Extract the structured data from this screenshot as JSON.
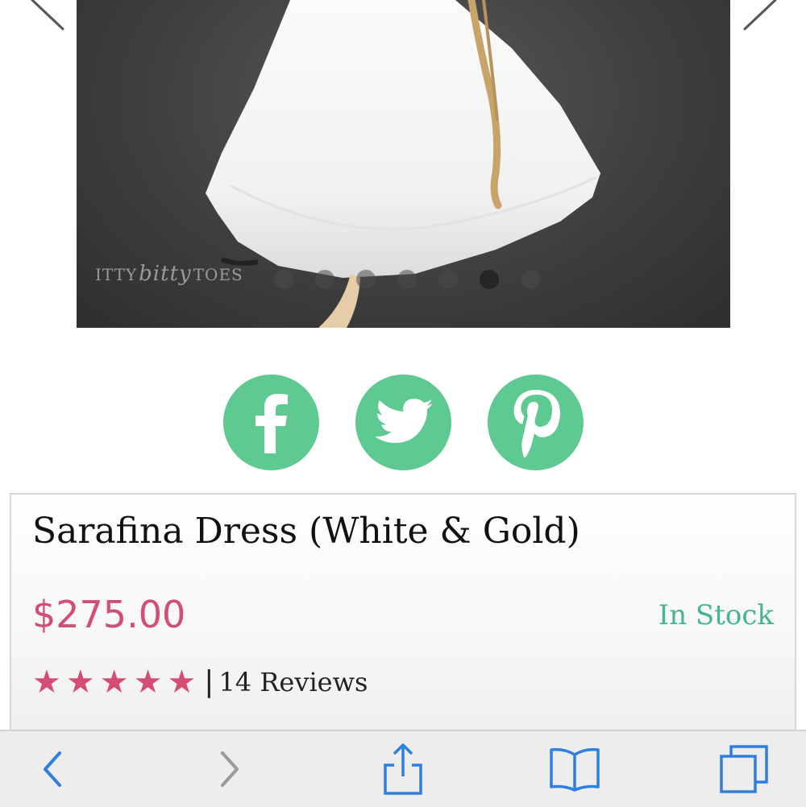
{
  "product": {
    "title": "Sarafina Dress (White & Gold)",
    "price": "$275.00",
    "stock_status": "In Stock",
    "rating_stars": 5,
    "reviews_text": "14 Reviews",
    "divider": "|"
  },
  "gallery": {
    "watermark_left": "ITTY",
    "watermark_script": "bitty",
    "watermark_right": "TOES",
    "dot_count": 7,
    "active_dot": 5
  },
  "social": [
    "facebook-icon",
    "twitter-icon",
    "pinterest-icon"
  ],
  "colors": {
    "social_green": "#5ec990",
    "price_pink": "#d44d72",
    "stock_green": "#43b78a",
    "toolbar_blue": "#2f7fe0"
  },
  "toolbar": [
    "back-icon",
    "forward-icon",
    "share-icon",
    "bookmarks-icon",
    "tabs-icon"
  ]
}
